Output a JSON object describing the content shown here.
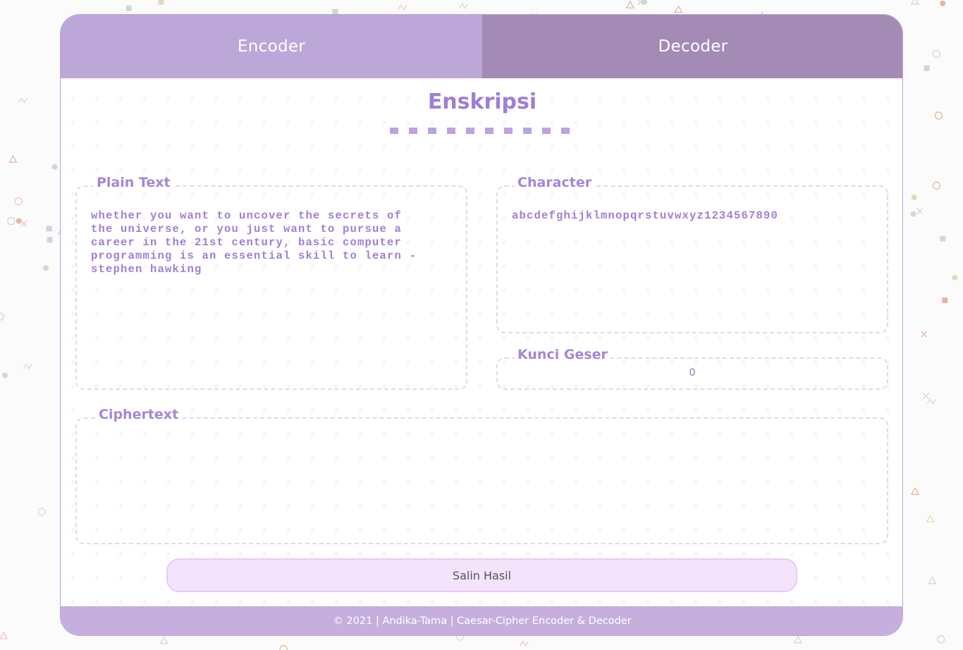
{
  "tabs": {
    "encoder": "Encoder",
    "decoder": "Decoder"
  },
  "page_title": "Enskripsi",
  "plain_text": {
    "legend": "Plain Text",
    "value": "whether you want to uncover the secrets of\nthe universe, or you just want to pursue a\ncareer in the 21st century, basic computer\nprogramming is an essential skill to learn -\nstephen hawking"
  },
  "character": {
    "legend": "Character",
    "value": "abcdefghijklmnopqrstuvwxyz1234567890"
  },
  "shift_key": {
    "legend": "Kunci Geser",
    "value": "0"
  },
  "ciphertext": {
    "legend": "Ciphertext",
    "value": ""
  },
  "copy_button": "Salin Hasil",
  "footer": "© 2021 | Andika-Tama | Caesar-Cipher Encoder & Decoder",
  "colors": {
    "accent": "#9f7ed6",
    "tab_active": "#bda6d8",
    "tab_inactive": "#a38bb6",
    "footer": "#c6aedf",
    "button_bg": "#f3e3fb"
  }
}
